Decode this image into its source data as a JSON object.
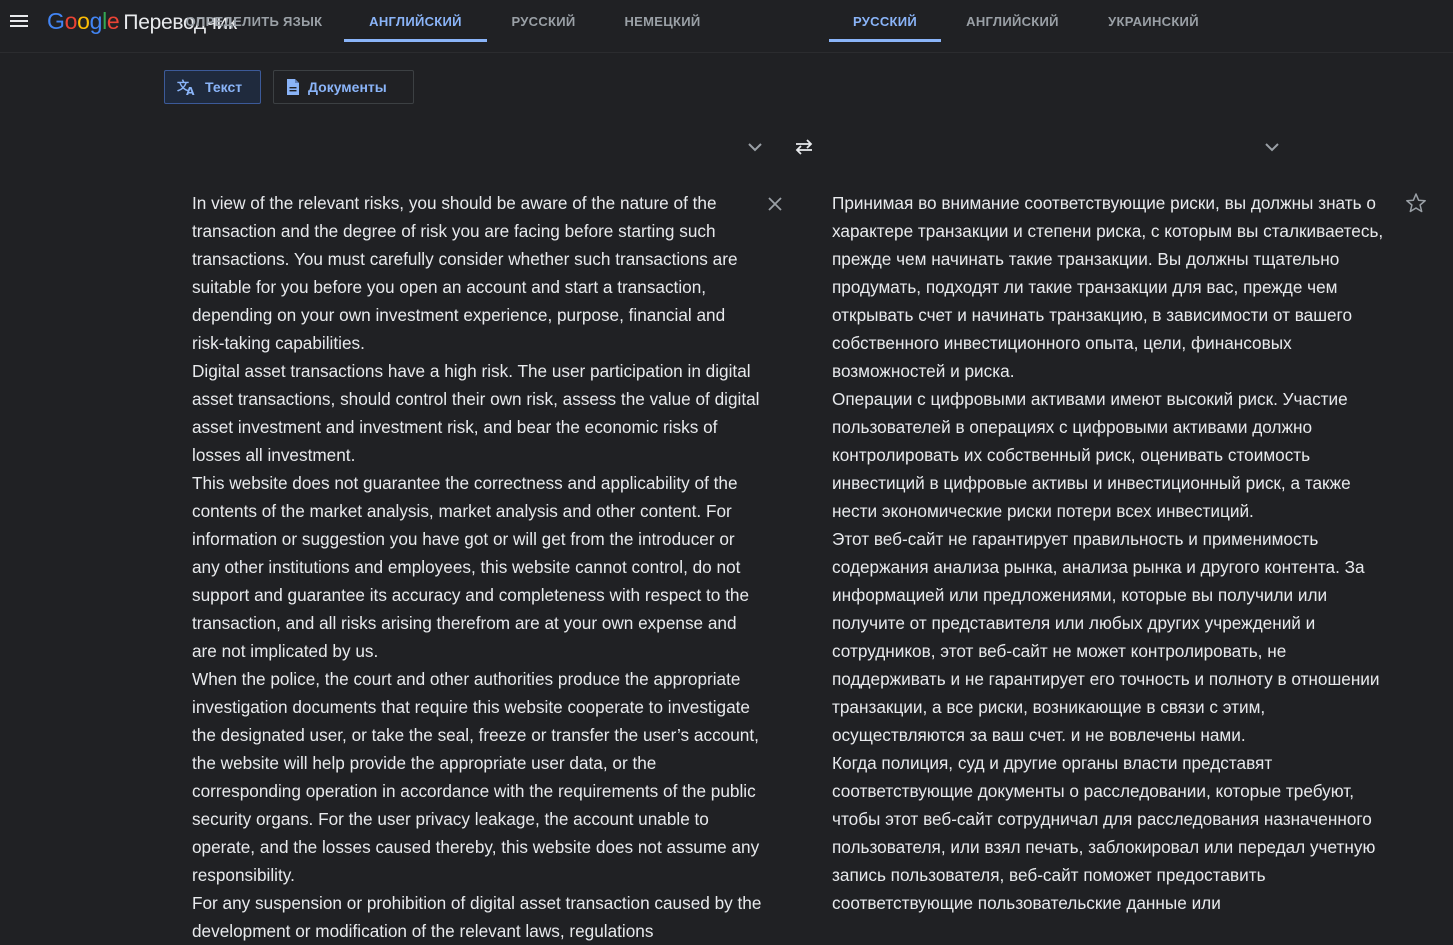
{
  "app": {
    "logo_text": "Google",
    "product_name": "Переводчик"
  },
  "modes": {
    "text_label": "Текст",
    "docs_label": "Документы"
  },
  "source_langs": [
    {
      "label": "ОПРЕДЕЛИТЬ ЯЗЫК",
      "active": false
    },
    {
      "label": "АНГЛИЙСКИЙ",
      "active": true
    },
    {
      "label": "РУССКИЙ",
      "active": false
    },
    {
      "label": "НЕМЕЦКИЙ",
      "active": false
    }
  ],
  "target_langs": [
    {
      "label": "РУССКИЙ",
      "active": true
    },
    {
      "label": "АНГЛИЙСКИЙ",
      "active": false
    },
    {
      "label": "УКРАИНСКИЙ",
      "active": false
    }
  ],
  "source_text": "In view of the relevant risks, you should be aware of the nature of the transaction and the degree of risk you are facing before starting such transactions. You must carefully consider whether such transactions are suitable for you before you open an account and start a transaction, depending on your own investment experience, purpose, financial and risk-taking capabilities.\nDigital asset transactions have a high risk. The user participation in digital asset transactions, should control their own risk, assess the value of digital asset investment and investment risk, and bear the economic risks of losses all investment.\nThis website does not guarantee the correctness and applicability of the contents of the market analysis, market analysis and other content. For information or suggestion you have got or will get from the introducer or any other institutions and employees, this website cannot control, do not support and guarantee its accuracy and completeness with respect to the transaction, and all risks arising therefrom are at your own expense and are not implicated by us.\nWhen the police, the court and other authorities produce the appropriate investigation documents that require this website cooperate to investigate the designated user, or take the seal, freeze or transfer the user’s account, the website will help provide the appropriate user data, or the corresponding operation in accordance with the requirements of the public security organs. For the user privacy leakage, the account unable to operate, and the losses caused thereby, this website does not assume any responsibility.\nFor any suspension or prohibition of digital asset transaction caused by the development or modification of the relevant laws, regulations",
  "target_text": "Принимая во внимание соответствующие риски, вы должны знать о характере транзакции и степени риска, с которым вы сталкиваетесь, прежде чем начинать такие транзакции. Вы должны тщательно продумать, подходят ли такие транзакции для вас, прежде чем открывать счет и начинать транзакцию, в зависимости от вашего собственного инвестиционного опыта, цели, финансовых возможностей и риска.\nОперации с цифровыми активами имеют высокий риск. Участие пользователей в операциях с цифровыми активами должно контролировать их собственный риск, оценивать стоимость инвестиций в цифровые активы и инвестиционный риск, а также нести экономические риски потери всех инвестиций.\nЭтот веб-сайт не гарантирует правильность и применимость содержания анализа рынка, анализа рынка и другого контента. За информацией или предложениями, которые вы получили или получите от представителя или любых других учреждений и сотрудников, этот веб-сайт не может контролировать, не поддерживать и не гарантирует его точность и полноту в отношении транзакции, а все риски, возникающие в связи с этим, осуществляются за ваш счет. и не вовлечены нами.\nКогда полиция, суд и другие органы власти представят соответствующие документы о расследовании, которые требуют, чтобы этот веб-сайт сотрудничал для расследования назначенного пользователя, или взял печать, заблокировал или передал учетную запись пользователя, веб-сайт поможет предоставить соответствующие пользовательские данные или",
  "colors": {
    "background": "#202124",
    "accent": "#8ab4f8",
    "muted": "#9aa0a6",
    "text": "#e8eaed"
  },
  "icons": [
    "menu-icon",
    "translate-icon",
    "document-icon",
    "chevron-down-icon",
    "swap-icon",
    "close-icon",
    "star-icon"
  ]
}
